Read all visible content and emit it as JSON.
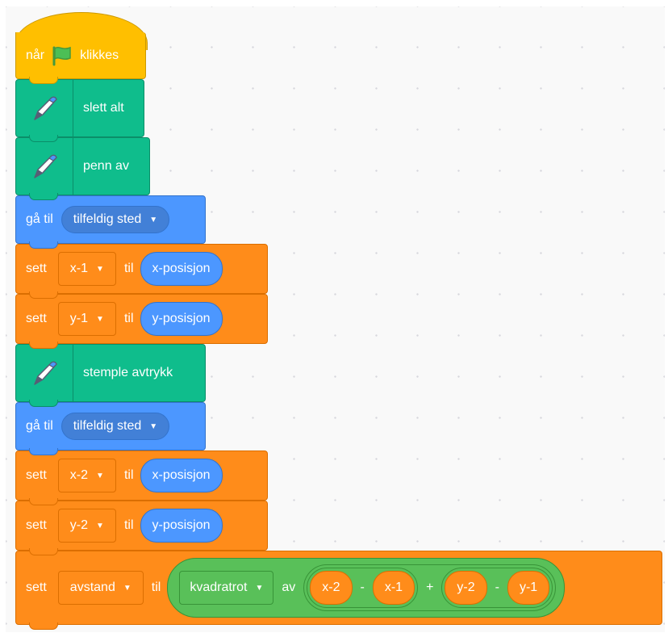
{
  "hat": {
    "word_before": "når",
    "flag_icon": "green-flag-icon",
    "word_after": "klikkes"
  },
  "blocks": {
    "clear": "slett alt",
    "pen_up": "penn av",
    "goto1": {
      "label": "gå til",
      "target": "tilfeldig sted"
    },
    "set_x1": {
      "label": "sett",
      "var": "x-1",
      "to": "til",
      "value": "x-posisjon"
    },
    "set_y1": {
      "label": "sett",
      "var": "y-1",
      "to": "til",
      "value": "y-posisjon"
    },
    "stamp": "stemple avtrykk",
    "goto2": {
      "label": "gå til",
      "target": "tilfeldig sted"
    },
    "set_x2": {
      "label": "sett",
      "var": "x-2",
      "to": "til",
      "value": "x-posisjon"
    },
    "set_y2": {
      "label": "sett",
      "var": "y-2",
      "to": "til",
      "value": "y-posisjon"
    },
    "set_dist": {
      "label": "sett",
      "var": "avstand",
      "to": "til",
      "func": "kvadratrot",
      "of": "av",
      "a1": "x-2",
      "minus1": "-",
      "a2": "x-1",
      "plus": "+",
      "b1": "y-2",
      "minus2": "-",
      "b2": "y-1"
    }
  },
  "colors": {
    "pen": "#0fbd8c",
    "motion": "#4c97ff",
    "variables": "#ff8c1a",
    "events": "#ffbf00",
    "operators": "#59c059"
  }
}
